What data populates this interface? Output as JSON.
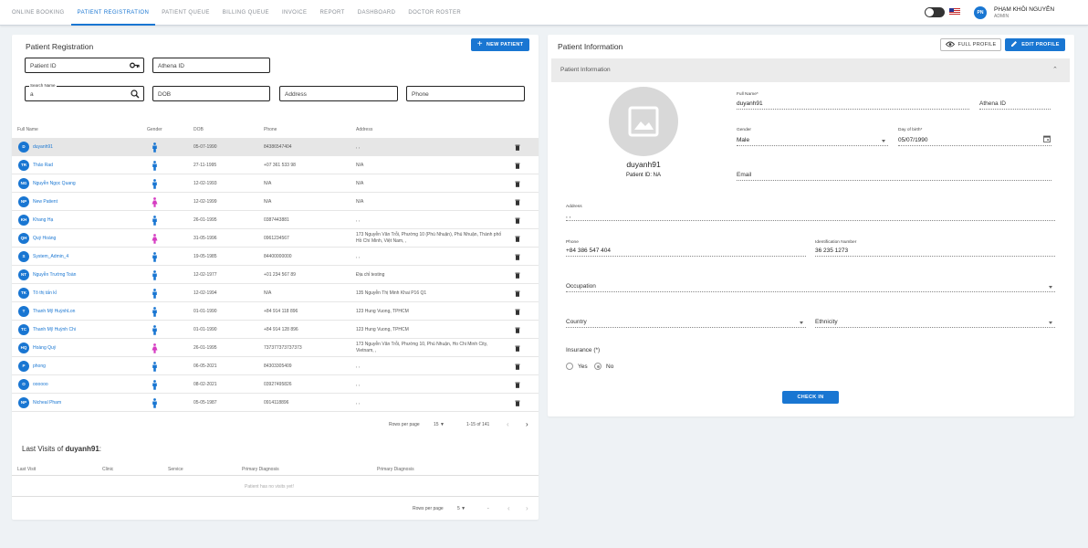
{
  "nav": {
    "items": [
      "ONLINE BOOKING",
      "PATIENT REGISTRATION",
      "PATIENT QUEUE",
      "BILLING QUEUE",
      "INVOICE",
      "REPORT",
      "DASHBOARD",
      "DOCTOR ROSTER"
    ],
    "active": "PATIENT REGISTRATION"
  },
  "user": {
    "initials": "PN",
    "name": "PHẠM KHÔI NGUYÊN",
    "role": "ADMIN"
  },
  "registration": {
    "title": "Patient Registration",
    "new_patient_label": "NEW PATIENT",
    "patient_id_placeholder": "Patient ID",
    "athena_id_placeholder": "Athena ID",
    "search_name_label": "Search Name",
    "search_name_value": "a",
    "dob_placeholder": "DOB",
    "address_placeholder": "Address",
    "phone_placeholder": "Phone",
    "columns": [
      "Full Name",
      "Gender",
      "DOB",
      "Phone",
      "Address"
    ],
    "rows": [
      {
        "initials": "D",
        "name": "duyanh91",
        "gender": "male",
        "dob": "05-07-1990",
        "phone": "84386547404",
        "address": ", ,",
        "selected": true
      },
      {
        "initials": "TR",
        "name": "Thảo Rad",
        "gender": "male",
        "dob": "27-11-1995",
        "phone": "+07 361 533 98",
        "address": "N/A"
      },
      {
        "initials": "NG",
        "name": "Nguyễn Ngọc Quang",
        "gender": "male",
        "dob": "12-02-1993",
        "phone": "N/A",
        "address": "N/A"
      },
      {
        "initials": "NP",
        "name": "New Patient",
        "gender": "female",
        "dob": "12-02-1999",
        "phone": "N/A",
        "address": "N/A"
      },
      {
        "initials": "KH",
        "name": "Khang Hạ",
        "gender": "male",
        "dob": "26-01-1995",
        "phone": "0387443881",
        "address": ", ,"
      },
      {
        "initials": "QH",
        "name": "Quý Hoàng",
        "gender": "female",
        "dob": "31-05-1996",
        "phone": "0961234567",
        "address": "173 Nguyễn Văn Trỗi, Phường 10 (Phú Nhuận), Phú Nhuận, Thành phố Hồ Chí Minh, Việt Nam, ,"
      },
      {
        "initials": "S",
        "name": "System_Admin_4",
        "gender": "male",
        "dob": "19-05-1985",
        "phone": "84400000000",
        "address": ", ,"
      },
      {
        "initials": "NT",
        "name": "Nguyễn Trường Toàn",
        "gender": "male",
        "dob": "12-02-1977",
        "phone": "+01 234 567 89",
        "address": "Địa chỉ testing"
      },
      {
        "initials": "TK",
        "name": "Tô thị tấn kỉ",
        "gender": "male",
        "dob": "12-02-1994",
        "phone": "N/A",
        "address": "135 Nguyễn Thị Minh Khai P16 Q1"
      },
      {
        "initials": "T",
        "name": "Thanh Mỹ HuỳnhLon",
        "gender": "male",
        "dob": "01-01-1990",
        "phone": "+84 914 118 896",
        "address": "123 Hung Vuong, TPHCM"
      },
      {
        "initials": "TC",
        "name": "Thanh Mỹ Huỳnh Chi",
        "gender": "male",
        "dob": "01-01-1990",
        "phone": "+84 914 128 896",
        "address": "123 Hung Vuong, TPHCM"
      },
      {
        "initials": "HQ",
        "name": "Hoàng Quý",
        "gender": "female",
        "dob": "26-01-1995",
        "phone": "737377373737373",
        "address": "173 Nguyễn Văn Trỗi, Phường 10, Phú Nhuận, Ho Chi Minh City, Vietnam, ,"
      },
      {
        "initials": "P",
        "name": "phong",
        "gender": "male",
        "dob": "06-05-2021",
        "phone": "84303305409",
        "address": ", ,"
      },
      {
        "initials": "O",
        "name": "oooooo",
        "gender": "male",
        "dob": "08-02-2021",
        "phone": "03927495826",
        "address": ", ,"
      },
      {
        "initials": "NP",
        "name": "Nicheal Pham",
        "gender": "male",
        "dob": "05-05-1987",
        "phone": "0914118896",
        "address": ", ,"
      }
    ],
    "pager": {
      "rows_label": "Rows per page",
      "rows_value": "15",
      "range": "1-15 of 141"
    },
    "visits_title_prefix": "Last Visits of",
    "visits_patient": "duyanh91",
    "visits_columns": [
      "Last Visit",
      "Clinic",
      "Service",
      "Primary Diagnosis",
      "Primary Diagnosis"
    ],
    "visits_empty": "Patient has no visits yet!",
    "visits_pager": {
      "rows_label": "Rows per page",
      "rows_value": "5",
      "range": "-"
    }
  },
  "info": {
    "title": "Patient Information",
    "full_profile_label": "FULL PROFILE",
    "edit_profile_label": "EDIT PROFILE",
    "section_title": "Patient Information",
    "display_name": "duyanh91",
    "patient_id_text": "Patient ID: NA",
    "full_name_label": "Full Name*",
    "full_name_value": "duyanh91",
    "athena_id_label": "Athena ID",
    "gender_label": "Gender",
    "gender_value": "Male",
    "dob_label": "Day of birth*",
    "dob_value": "05/07/1990",
    "email_label": "Email",
    "address_label": "Address",
    "address_value": ", ,",
    "phone_label": "Phone",
    "phone_value": "+84 386 547 404",
    "idnum_label": "Identification Number",
    "idnum_value": "36 235 1273",
    "occupation_label": "Occupation",
    "country_label": "Country",
    "ethnicity_label": "Ethnicity",
    "insurance_label": "Insurance (*)",
    "yes_label": "Yes",
    "no_label": "No",
    "check_in_label": "CHECK IN"
  },
  "colors": {
    "primary": "#1976d2",
    "male": "#1976d2",
    "female": "#d63cc2"
  }
}
